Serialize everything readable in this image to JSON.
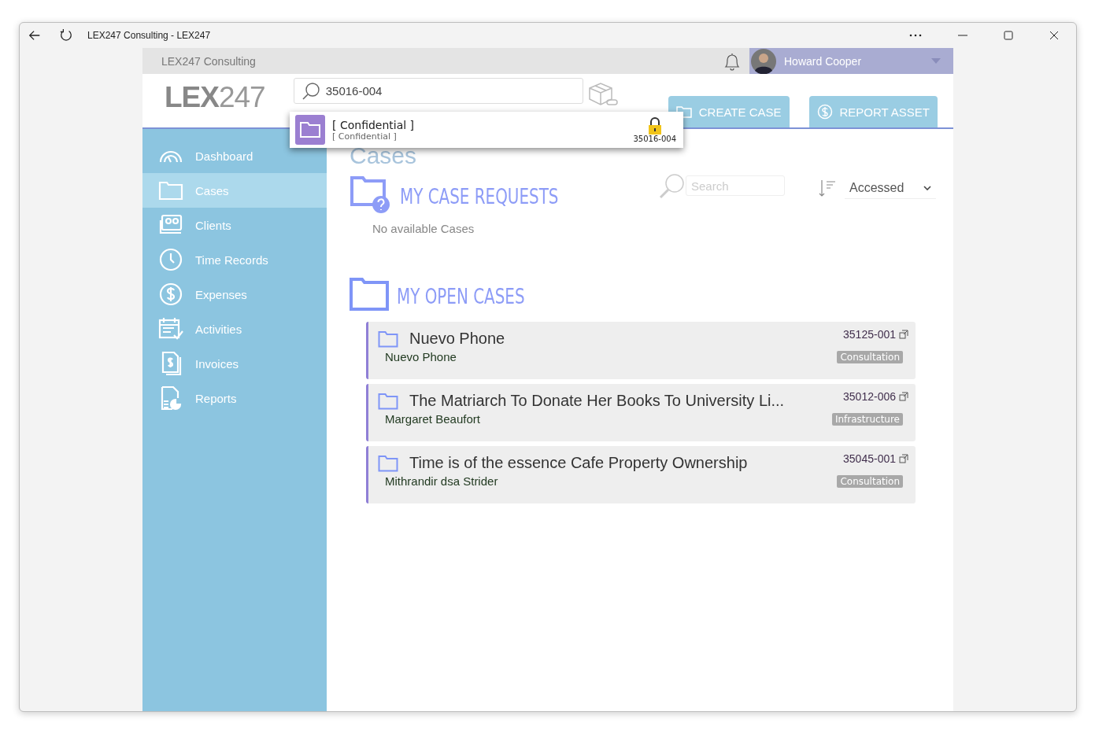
{
  "browser": {
    "title": "LEX247 Consulting - LEX247"
  },
  "topbar": {
    "company": "LEX247 Consulting",
    "user": "Howard Cooper"
  },
  "header": {
    "logo": {
      "strong": "LEX",
      "light": "247"
    },
    "search": {
      "value": "35016-004"
    },
    "search_results": [
      {
        "title": "[ Confidential ]",
        "subtitle": "[ Confidential ]",
        "number": "35016-004",
        "locked": true
      }
    ],
    "buttons": [
      {
        "label": "CREATE CASE"
      },
      {
        "label": "REPORT ASSET"
      }
    ]
  },
  "sidebar": {
    "items": [
      {
        "label": "Dashboard",
        "selected": false
      },
      {
        "label": "Cases",
        "selected": true
      },
      {
        "label": "Clients",
        "selected": false
      },
      {
        "label": "Time Records",
        "selected": false
      },
      {
        "label": "Expenses",
        "selected": false
      },
      {
        "label": "Activities",
        "selected": false
      },
      {
        "label": "Invoices",
        "selected": false
      },
      {
        "label": "Reports",
        "selected": false
      }
    ]
  },
  "page_title": "Cases",
  "case_requests": {
    "title": "MY CASE REQUESTS",
    "search": {
      "placeholder": "Search"
    },
    "sort": {
      "value": "Accessed"
    },
    "empty": "No available Cases"
  },
  "open_cases": {
    "title": "MY OPEN CASES",
    "cases": [
      {
        "title": "Nuevo Phone",
        "client": "Nuevo Phone",
        "number": "35125-001",
        "tag": "Consultation"
      },
      {
        "title": "The Matriarch To Donate Her Books To University Li...",
        "client": "Margaret Beaufort",
        "number": "35012-006",
        "tag": "Infrastructure"
      },
      {
        "title": "Time is of the essence Cafe Property Ownership",
        "client": "Mithrandir dsa Strider",
        "number": "35045-001",
        "tag": "Consultation"
      }
    ]
  }
}
